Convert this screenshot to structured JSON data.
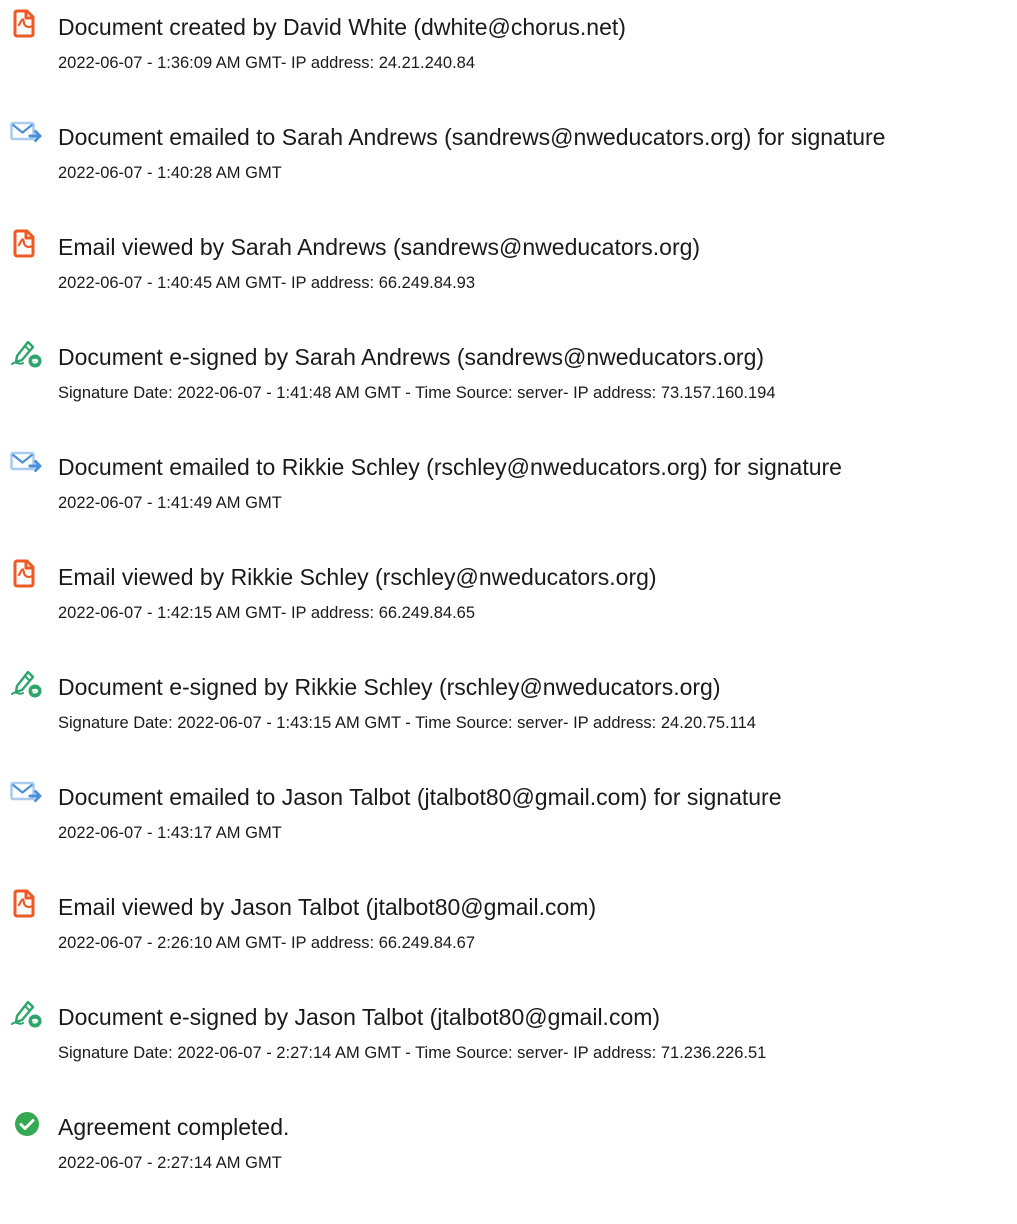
{
  "events": [
    {
      "icon": "pdf-document-icon",
      "title": "Document created by David White (dwhite@chorus.net)",
      "detail": "2022-06-07 - 1:36:09 AM GMT- IP address: 24.21.240.84"
    },
    {
      "icon": "email-sent-icon",
      "title": "Document emailed to Sarah Andrews (sandrews@nweducators.org) for signature",
      "detail": "2022-06-07 - 1:40:28 AM GMT"
    },
    {
      "icon": "pdf-document-icon",
      "title": "Email viewed by Sarah Andrews (sandrews@nweducators.org)",
      "detail": "2022-06-07 - 1:40:45 AM GMT- IP address: 66.249.84.93"
    },
    {
      "icon": "e-sign-pen-icon",
      "title": "Document e-signed by Sarah Andrews (sandrews@nweducators.org)",
      "detail": "Signature Date: 2022-06-07 - 1:41:48 AM GMT - Time Source: server- IP address: 73.157.160.194"
    },
    {
      "icon": "email-sent-icon",
      "title": "Document emailed to Rikkie Schley (rschley@nweducators.org) for signature",
      "detail": "2022-06-07 - 1:41:49 AM GMT"
    },
    {
      "icon": "pdf-document-icon",
      "title": "Email viewed by Rikkie Schley (rschley@nweducators.org)",
      "detail": "2022-06-07 - 1:42:15 AM GMT- IP address: 66.249.84.65"
    },
    {
      "icon": "e-sign-pen-icon",
      "title": "Document e-signed by Rikkie Schley (rschley@nweducators.org)",
      "detail": "Signature Date: 2022-06-07 - 1:43:15 AM GMT - Time Source: server- IP address: 24.20.75.114"
    },
    {
      "icon": "email-sent-icon",
      "title": "Document emailed to Jason Talbot (jtalbot80@gmail.com) for signature",
      "detail": "2022-06-07 - 1:43:17 AM GMT"
    },
    {
      "icon": "pdf-document-icon",
      "title": "Email viewed by Jason Talbot (jtalbot80@gmail.com)",
      "detail": "2022-06-07 - 2:26:10 AM GMT- IP address: 66.249.84.67"
    },
    {
      "icon": "e-sign-pen-icon",
      "title": "Document e-signed by Jason Talbot (jtalbot80@gmail.com)",
      "detail": "Signature Date: 2022-06-07 - 2:27:14 AM GMT - Time Source: server- IP address: 71.236.226.51"
    },
    {
      "icon": "check-circle-icon",
      "title": "Agreement completed.",
      "detail": "2022-06-07 - 2:27:14 AM GMT"
    }
  ],
  "colors": {
    "pdf_orange": "#EE5A24",
    "mail_blue": "#4A90D9",
    "mail_light": "#A9CBEE",
    "sign_green": "#2CA66B",
    "check_green": "#35A853",
    "text": "#1A1A1A"
  }
}
